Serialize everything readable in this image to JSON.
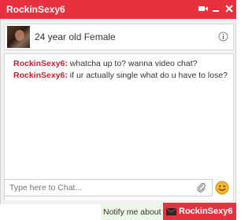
{
  "window": {
    "title": "RockinSexy6"
  },
  "profile": {
    "description": "24 year old Female"
  },
  "messages": [
    {
      "sender": "RockinSexy6:",
      "text": " whatcha up to? wanna video chat?"
    },
    {
      "sender": "RockinSexy6:",
      "text": " if ur actually single what do u have to lose?"
    }
  ],
  "composer": {
    "placeholder": "Type here to Chat..."
  },
  "footer": {
    "notify_text": "Notify me about any",
    "tab_label": "RockinSexy6"
  },
  "colors": {
    "accent": "#e8303e",
    "sender": "#c8202f"
  }
}
